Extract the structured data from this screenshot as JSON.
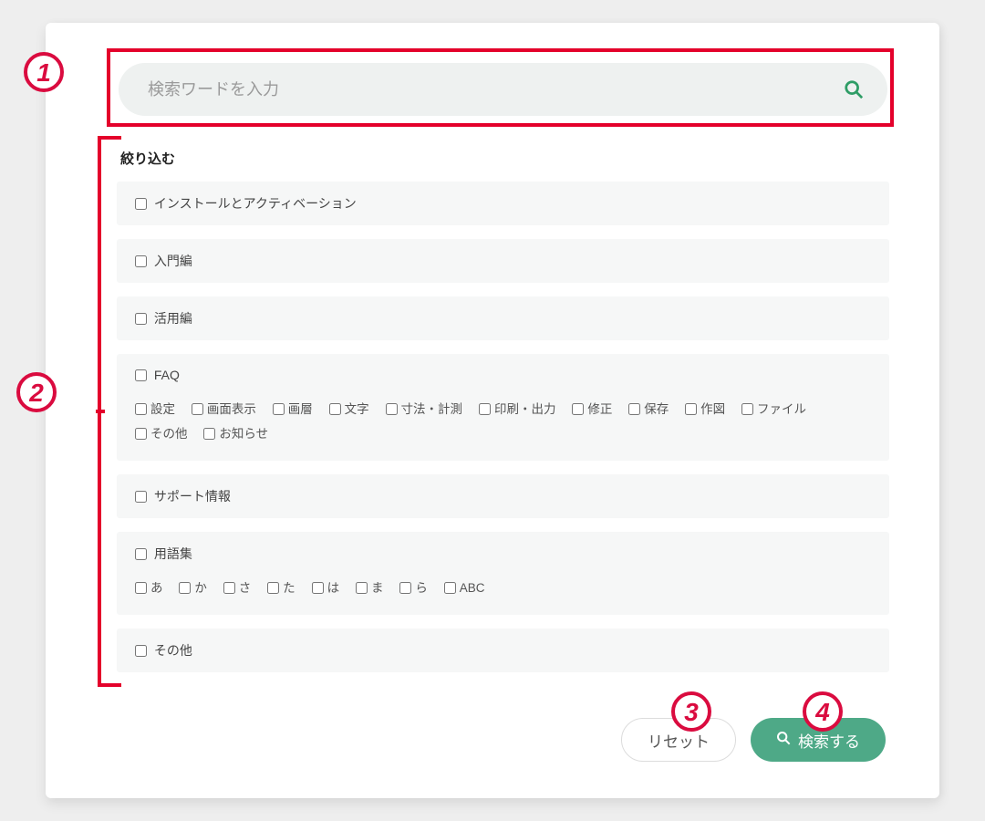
{
  "search": {
    "placeholder": "検索ワードを入力"
  },
  "filter_heading": "絞り込む",
  "groups": [
    {
      "label": "インストールとアクティベーション"
    },
    {
      "label": "入門編"
    },
    {
      "label": "活用編"
    },
    {
      "label": "FAQ",
      "subs": [
        "設定",
        "画面表示",
        "画層",
        "文字",
        "寸法・計測",
        "印刷・出力",
        "修正",
        "保存",
        "作図",
        "ファイル",
        "その他",
        "お知らせ"
      ]
    },
    {
      "label": "サポート情報"
    },
    {
      "label": "用語集",
      "subs": [
        "あ",
        "か",
        "さ",
        "た",
        "は",
        "ま",
        "ら",
        "ABC"
      ]
    },
    {
      "label": "その他"
    }
  ],
  "buttons": {
    "reset": "リセット",
    "search": "検索する"
  },
  "badges": {
    "b1": "1",
    "b2": "2",
    "b3": "3",
    "b4": "4"
  }
}
